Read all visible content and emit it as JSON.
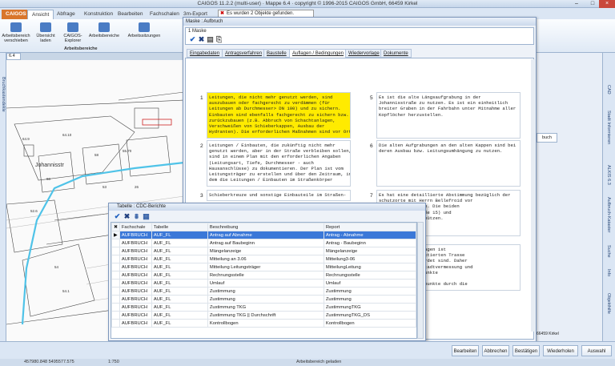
{
  "window": {
    "title": "CAIGOS 11.2.2 (multi-user) · Mappe 6.4 · copyright © 1996-2015 CAIGOS GmbH, 66459 Kirkel"
  },
  "notification": {
    "text": "Es wurden 2 Objekte gefunden."
  },
  "ribbon": {
    "tabs": [
      "CAIGOS",
      "Ansicht",
      "Abfrage",
      "Konstruktion",
      "Bearbeiten",
      "Fachschalen",
      "3m-Export"
    ],
    "buttons": [
      "Arbeitsbereich verschieben",
      "Übersicht laden",
      "CAIGOS-Explorer",
      "Arbeitsbereiche",
      "Arbeitssitzungen"
    ],
    "group_label": "Arbeitsbereiche"
  },
  "doc_tab": "6.4",
  "left_strip_label": "Bruchkastendekle",
  "right_strip": [
    "CAD",
    "Stadt Informieren",
    "ALKIS 6.3",
    "Aufbruch-Kataster",
    "Suche",
    "Info",
    "Objekthilfe"
  ],
  "right_panel": {
    "btn": "buch",
    "footer": "66459 Kirkel"
  },
  "map": {
    "street": "Johannisstr",
    "numbers": [
      "64.9",
      "64.10",
      "58",
      "55.70",
      "60",
      "52.6",
      "53",
      "26",
      "54",
      "54.1"
    ]
  },
  "dialog": {
    "title": "Maske : Aufbruch",
    "panel_label": "1 Maske",
    "tabs": [
      "Eingabedaten",
      "Antragsverfahren",
      "Baustelle",
      "Auflagen / Bedingungen",
      "Wiedervorlage",
      "Dokumente"
    ],
    "active_tab": "Auflagen / Bedingungen",
    "conditions": [
      {
        "n": "1",
        "text": "Leitungen, die nicht mehr genutzt werden, sind\nauszubauen oder fachgerecht zu verdämmen (für\nLeitungen ab Durchmesser> DN 100) und zu sichern.\nEinbauten sind ebenfalls fachgerecht zu sichern bzw.\nzurückzubauen (z.B. Abbruch von Schachtanlagen,\nVerschweißen von Schieberkappen, Ausbau der\nHydranten). Die erforderlichen Maßnahmen sind vor Ort",
        "hl": true
      },
      {
        "n": "2",
        "text": "Leitungen / Einbauten, die zukünftig nicht mehr\ngenutzt werden, aber in der Straße verbleiben sollen,\nsind in einem Plan mit den erforderlichen Angaben\n(Leitungsart, Tiefe, Durchmesser - auch\nHausanschlüsse) zu dokumentieren. Der Plan ist vom\nLeitungsträger zu erstellen und über den Zeitraum, in\ndem die Leitungen / Einbauten im Straßenkörper",
        "hl": false
      },
      {
        "n": "3",
        "text": "Schieberkreuze und sonstige Einbauteile im Straßen-",
        "hl": false
      },
      {
        "n": "5",
        "text": "Es ist die alte Längsaufgrabung in der\nJohannisstraße zu nutzen. Es ist ein einheitlich\nbreiter Graben in der Fahrbahn unter Mitnahme aller\nKopflöcher herzustellen.",
        "hl": false
      },
      {
        "n": "6",
        "text": "Die alten Aufgrabungen an den alten Kappen sind bei\nderen Ausbau bzw. Leitungsumhängung zu nutzen.",
        "hl": false
      },
      {
        "n": "7",
        "text": "Es hat eine detaillierte Abstimmung bezüglich der\nschutzorte mit Herrn Bellefroid vor\nmungen zu erfolgen. Die beiden\nHöhe Johannisstraße 15) und\nd besonders zu schützen.",
        "hl": false
      },
      {
        "n": "9",
        "text": "Vermessungsunterlagen ist\nBereich der projektierten Trasse\n62 und 1428 gefährdet sind. Daher\nabteilung 6.2 - Stadtvermessung und\nzuvor genannten Punkte\nveranlasst.\npunkte oder Grenzpunkte durch die",
        "hl": false
      }
    ]
  },
  "table_dialog": {
    "title": "Tabelle : CDC-Berichte",
    "columns": [
      "Fachschale",
      "Tabelle",
      "Beschreibung",
      "Report"
    ],
    "rows": [
      [
        "AUFBRUCH",
        "AUF_FL",
        "Antrag auf Abnahme",
        "Antrag - Abnahme"
      ],
      [
        "AUFBRUCH",
        "AUF_FL",
        "Antrag auf Baubeginn",
        "Antrag - Baubeginn"
      ],
      [
        "AUFBRUCH",
        "AUF_FL",
        "Mängelanzeige",
        "Mängelanzeige"
      ],
      [
        "AUFBRUCH",
        "AUF_FL",
        "Mitteilung an 3.06",
        "Mitteilung3-06"
      ],
      [
        "AUFBRUCH",
        "AUF_FL",
        "Mitteilung Leitungsträger",
        "MitteilungLeitung"
      ],
      [
        "AUFBRUCH",
        "AUF_FL",
        "Rechnungsstelle",
        "Rechnungsstelle"
      ],
      [
        "AUFBRUCH",
        "AUF_FL",
        "Umlauf",
        "Umlauf"
      ],
      [
        "AUFBRUCH",
        "AUF_FL",
        "Zustimmung",
        "Zustimmung"
      ],
      [
        "AUFBRUCH",
        "AUF_FL",
        "Zustimmung",
        "Zustimmung"
      ],
      [
        "AUFBRUCH",
        "AUF_FL",
        "Zustimmung TKG",
        "ZustimmungTKG"
      ],
      [
        "AUFBRUCH",
        "AUF_FL",
        "Zustimmung TKG || Durchschrift",
        "ZustimmungTKG_DS"
      ],
      [
        "AUFBRUCH",
        "AUF_FL",
        "Kontrollbogen",
        "Kontrollbogen"
      ]
    ]
  },
  "bottom_buttons": [
    "Bearbeiten",
    "Abbrechen",
    "Bestätigen",
    "Wiederholen",
    "Auswahl"
  ],
  "status": {
    "coords": "457980.848    5495577.575",
    "scale": "1:750",
    "msg": "Arbeitsbereich geladen"
  }
}
